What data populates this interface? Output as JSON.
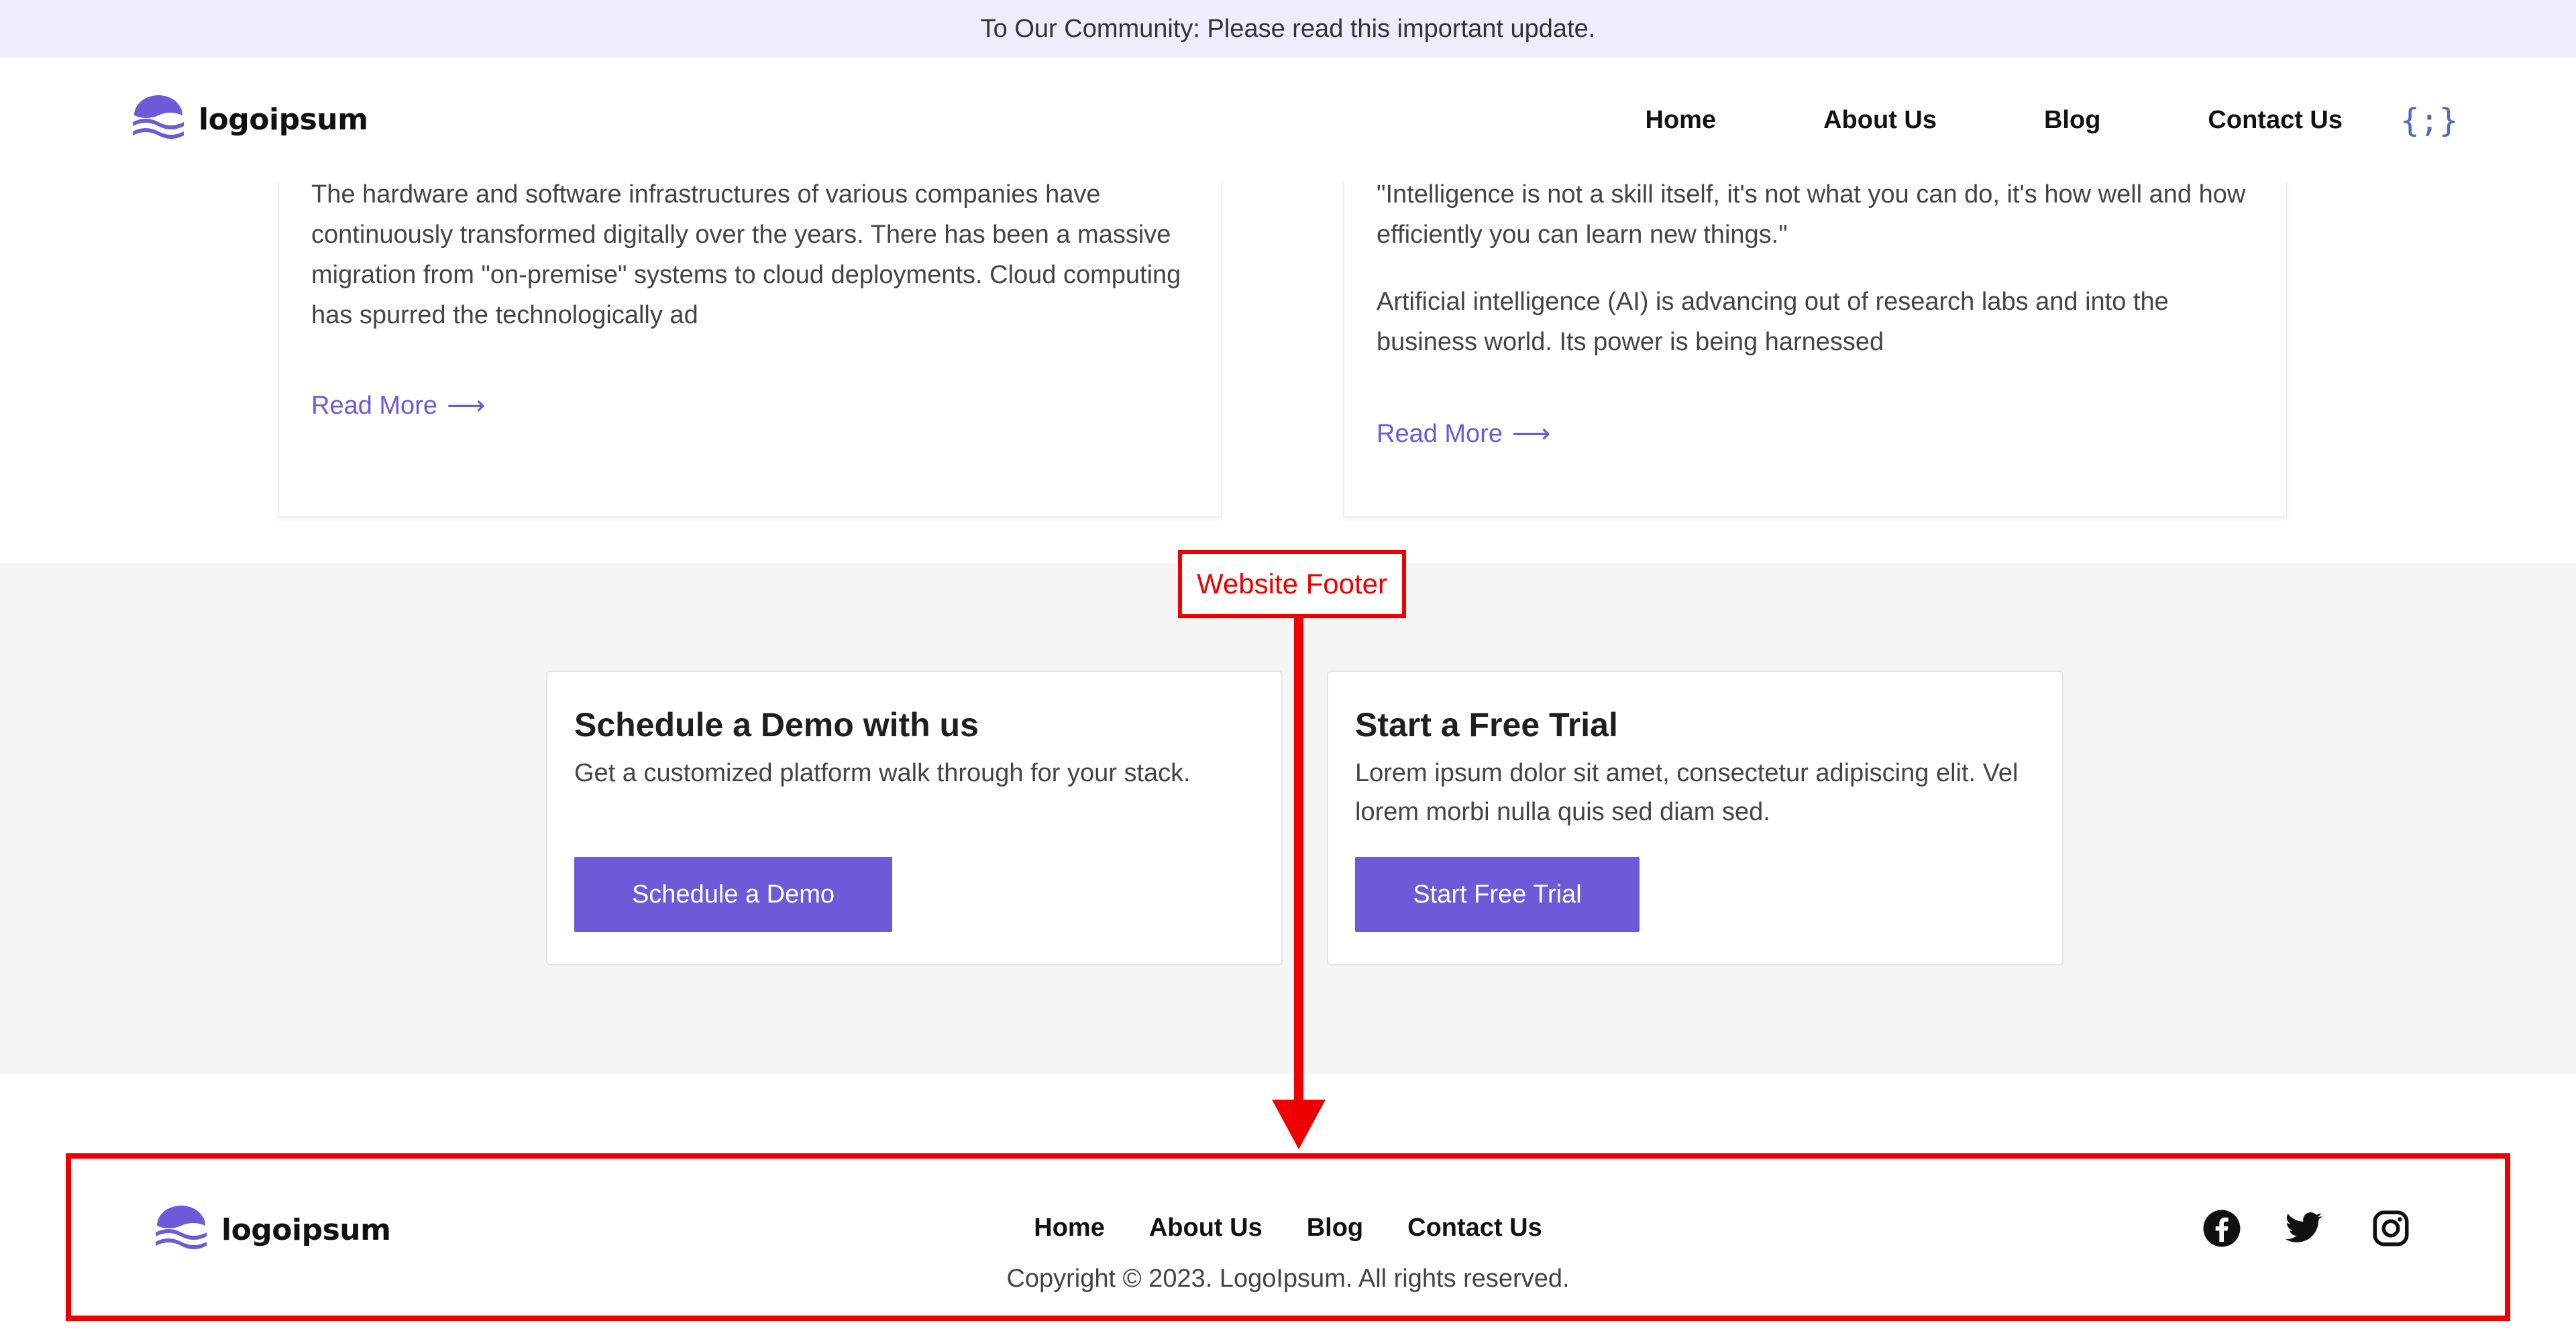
{
  "announcement": {
    "text": "To Our Community: Please read this important update."
  },
  "brand": {
    "name": "logoipsum",
    "accent": "#6c5ad8"
  },
  "header": {
    "nav": [
      "Home",
      "About Us",
      "Blog",
      "Contact Us"
    ],
    "code_icon": "{;}"
  },
  "blog_cards": [
    {
      "excerpt": "The hardware and software infrastructures of various companies have continuously transformed digitally over the years. There has been a massive migration from \"on-premise\" systems to cloud deployments. Cloud computing has spurred the technologically ad",
      "read_more": "Read More"
    },
    {
      "quote": "\"Intelligence is not a skill itself, it's not what you can do, it's how well and how efficiently you can learn new things.\"",
      "excerpt": "Artificial intelligence (AI) is advancing out of research labs and into the business world. Its power is being harnessed",
      "read_more": "Read More"
    }
  ],
  "cta": {
    "demo": {
      "title": "Schedule a Demo with us",
      "description": "Get a customized platform walk through for your stack.",
      "button": "Schedule a Demo"
    },
    "trial": {
      "title": "Start a Free Trial",
      "description": "Lorem ipsum dolor sit amet, consectetur adipiscing elit. Vel lorem morbi nulla quis sed diam sed.",
      "button": "Start Free Trial"
    }
  },
  "annotation": {
    "label": "Website Footer",
    "color": "#ee0000"
  },
  "footer": {
    "nav": [
      "Home",
      "About Us",
      "Blog",
      "Contact Us"
    ],
    "copyright": "Copyright © 2023. LogoIpsum. All rights reserved.",
    "social": [
      "facebook-icon",
      "twitter-icon",
      "instagram-icon"
    ]
  }
}
